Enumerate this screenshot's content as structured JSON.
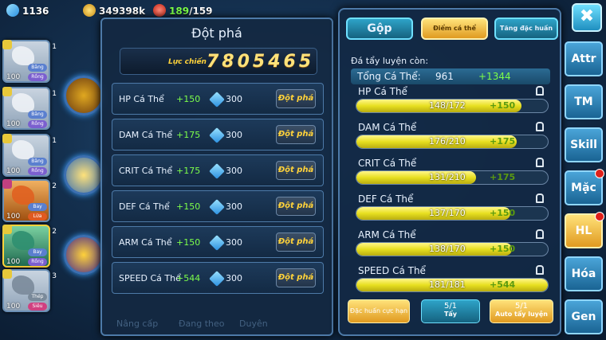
{
  "resources": {
    "gems": "1136",
    "gold": "349398k",
    "stamina": "189",
    "stamina_max": "/159"
  },
  "team": [
    {
      "level": "100",
      "type1": "Băng",
      "type2": "Rồng",
      "num": "1"
    },
    {
      "level": "100",
      "type1": "Băng",
      "type2": "Rồng",
      "num": "1"
    },
    {
      "level": "100",
      "type1": "Băng",
      "type2": "Rồng",
      "num": "1"
    },
    {
      "level": "100",
      "type1": "Bay",
      "type2": "Lửa",
      "num": "2"
    },
    {
      "level": "100",
      "type1": "Bay",
      "type2": "Rồng",
      "num": "2"
    },
    {
      "level": "100",
      "type1": "Thép",
      "type2": "Siêu",
      "num": "3"
    }
  ],
  "breakthrough": {
    "title": "Đột phá",
    "power_label": "Lực chiến",
    "power_value": "7805465",
    "rows": [
      {
        "name": "HP Cá Thể",
        "bonus": "+150",
        "cost": "300",
        "button": "Đột phá"
      },
      {
        "name": "DAM Cá Thể",
        "bonus": "+175",
        "cost": "300",
        "button": "Đột phá"
      },
      {
        "name": "CRIT Cá Thể",
        "bonus": "+175",
        "cost": "300",
        "button": "Đột phá"
      },
      {
        "name": "DEF Cá Thể",
        "bonus": "+150",
        "cost": "300",
        "button": "Đột phá"
      },
      {
        "name": "ARM Cá Thể",
        "bonus": "+150",
        "cost": "300",
        "button": "Đột phá"
      },
      {
        "name": "SPEED Cá Thể",
        "bonus": "+544",
        "cost": "300",
        "button": "Đột phá"
      }
    ],
    "bottom_tabs": [
      "Nâng cấp",
      "Đang theo",
      "Duyên"
    ]
  },
  "individual": {
    "tabs": {
      "gop": "Gộp",
      "diem": "Điểm cá thể",
      "tang": "Tăng đặc huấn"
    },
    "subtitle": "Đá tẩy luyện còn:",
    "total_label": "Tổng Cá Thể:",
    "total_value": "961",
    "total_bonus": "+1344",
    "bars": [
      {
        "name": "HP Cá Thể",
        "current": 148,
        "max": 172,
        "ratio": "148/172",
        "bonus": "+150"
      },
      {
        "name": "DAM Cá Thể",
        "current": 176,
        "max": 210,
        "ratio": "176/210",
        "bonus": "+175"
      },
      {
        "name": "CRIT Cá Thể",
        "current": 131,
        "max": 210,
        "ratio": "131/210",
        "bonus": "+175"
      },
      {
        "name": "DEF Cá Thể",
        "current": 137,
        "max": 170,
        "ratio": "137/170",
        "bonus": "+150"
      },
      {
        "name": "ARM Cá Thể",
        "current": 138,
        "max": 170,
        "ratio": "138/170",
        "bonus": "+150"
      },
      {
        "name": "SPEED Cá Thể",
        "current": 181,
        "max": 181,
        "ratio": "181/181",
        "bonus": "+544"
      }
    ],
    "buttons": {
      "dac_huan": "Đặc huấn cực hạn",
      "tay_count": "5/1",
      "tay_label": "Tẩy",
      "auto_count": "5/1",
      "auto_label": "Auto tẩy luyện"
    }
  },
  "side_menu": [
    "Attr",
    "TM",
    "Skill",
    "Mặc",
    "HL",
    "Hóa",
    "Gen"
  ],
  "side_alerts": [
    "Mặc",
    "HL"
  ],
  "close_label": "✖"
}
